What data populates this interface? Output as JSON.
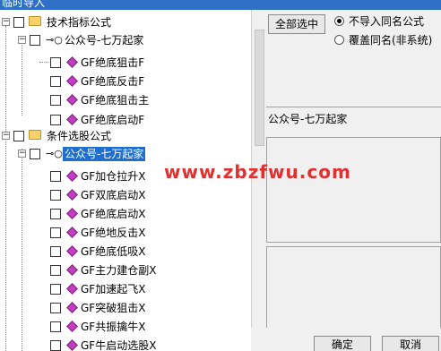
{
  "window": {
    "title": "临时导入"
  },
  "tree": {
    "group1": {
      "label": "技术指标公式",
      "sub": "公众号-七万起家",
      "items": [
        "GF绝底狙击F",
        "GF绝底反击F",
        "GF绝底狙击主",
        "GF绝底启动F"
      ]
    },
    "group2": {
      "label": "条件选股公式",
      "sub": "公众号-七万起家",
      "items": [
        "GF加仓拉升X",
        "GF双底启动X",
        "GF绝底启动X",
        "GF绝地反击X",
        "GF绝底低吸X",
        "GF主力建仓副X",
        "GF加速起飞X",
        "GF突破狙击X",
        "GF共振擒牛X",
        "GF牛启动选股X"
      ]
    }
  },
  "right": {
    "select_all_label": "全部选中",
    "options": [
      "不导入同名公式",
      "覆盖同名(非系统)"
    ],
    "selected_option": 0,
    "info_text": "公众号-七万起家"
  },
  "watermark": "www.zbzfwu.com",
  "footer": {
    "ok_label": "确定",
    "cancel_label": "取消"
  },
  "colors": {
    "selection": "#1f6fd1",
    "title_bar": "#2f6fc6",
    "watermark": "#e03030"
  }
}
